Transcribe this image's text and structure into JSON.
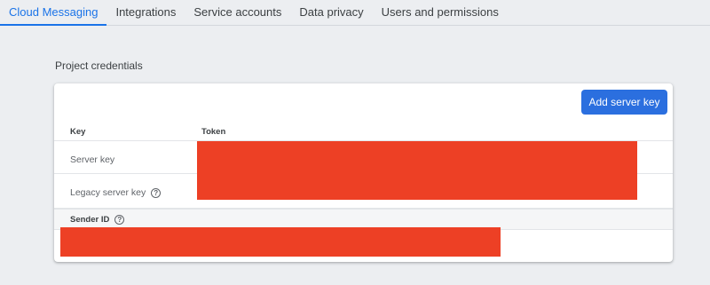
{
  "tabs": [
    {
      "label": "Cloud Messaging",
      "active": true
    },
    {
      "label": "Integrations",
      "active": false
    },
    {
      "label": "Service accounts",
      "active": false
    },
    {
      "label": "Data privacy",
      "active": false
    },
    {
      "label": "Users and permissions",
      "active": false
    }
  ],
  "section": {
    "title": "Project credentials"
  },
  "card": {
    "add_button_label": "Add server key",
    "columns": {
      "key": "Key",
      "token": "Token"
    },
    "rows": [
      {
        "label": "Server key",
        "has_help": false
      },
      {
        "label": "Legacy server key",
        "has_help": true
      }
    ],
    "sender_id": {
      "label": "Sender ID",
      "has_help": true
    }
  },
  "icons": {
    "help": "help-circle-icon"
  },
  "colors": {
    "accent": "#1a73e8",
    "button": "#2b6fdf",
    "redaction": "#ed4025"
  }
}
